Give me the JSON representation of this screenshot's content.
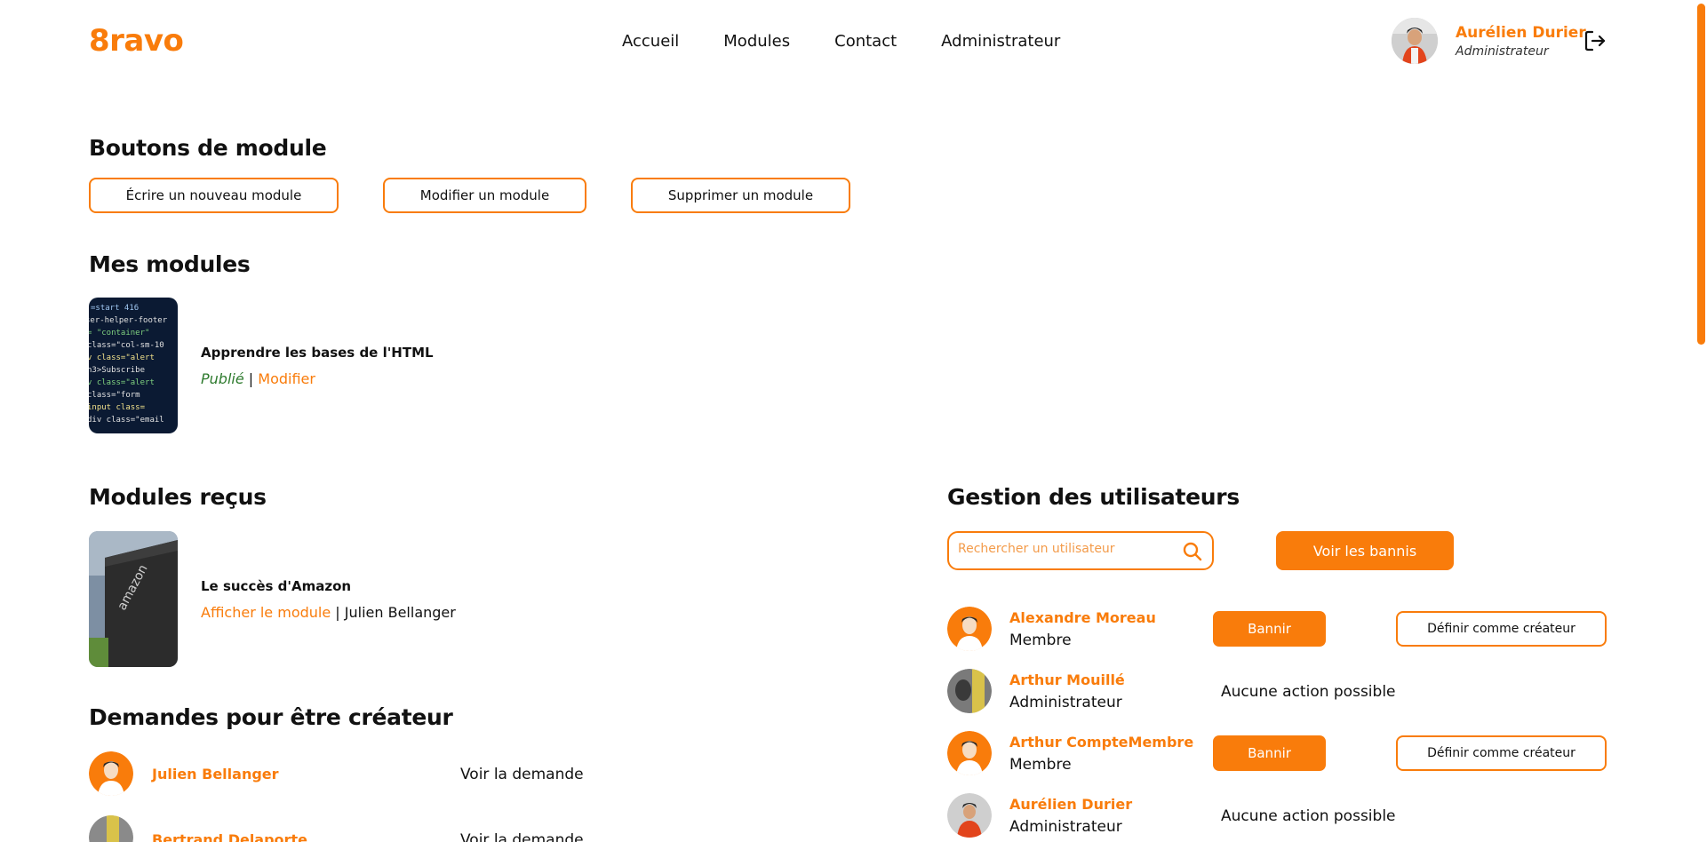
{
  "brand": {
    "logo": "8ravo",
    "accent": "#f97c0b"
  },
  "nav": {
    "items": [
      "Accueil",
      "Modules",
      "Contact",
      "Administrateur"
    ]
  },
  "user": {
    "name": "Aurélien Durier",
    "role": "Administrateur"
  },
  "icons": {
    "logout": "logout-icon",
    "search": "search-icon"
  },
  "module_buttons": {
    "title": "Boutons de module",
    "write": "Écrire un nouveau module",
    "edit": "Modifier un module",
    "delete": "Supprimer un module"
  },
  "my_modules": {
    "title": "Mes modules",
    "items": [
      {
        "title": "Apprendre les bases de l'HTML",
        "status": "Publié",
        "separator": "|",
        "action": "Modifier"
      }
    ]
  },
  "received_modules": {
    "title": "Modules reçus",
    "items": [
      {
        "title": "Le succès d'Amazon",
        "action": "Afficher le module",
        "separator": "|",
        "author": "Julien Bellanger"
      }
    ]
  },
  "creator_requests": {
    "title": "Demandes pour être créateur",
    "items": [
      {
        "name": "Julien Bellanger",
        "action": "Voir la demande"
      },
      {
        "name": "Bertrand Delaporte",
        "action": "Voir la demande"
      }
    ]
  },
  "user_management": {
    "title": "Gestion des utilisateurs",
    "search_placeholder": "Rechercher un utilisateur",
    "banned_button": "Voir les bannis",
    "users": [
      {
        "name": "Alexandre Moreau",
        "role": "Membre",
        "ban": "Bannir",
        "make_creator": "Définir comme créateur"
      },
      {
        "name": "Arthur Mouillé",
        "role": "Administrateur",
        "no_action": "Aucune action possible"
      },
      {
        "name": "Arthur CompteMembre",
        "role": "Membre",
        "ban": "Bannir",
        "make_creator": "Définir comme créateur"
      },
      {
        "name": "Aurélien Durier",
        "role": "Administrateur",
        "no_action": "Aucune action possible"
      }
    ]
  }
}
